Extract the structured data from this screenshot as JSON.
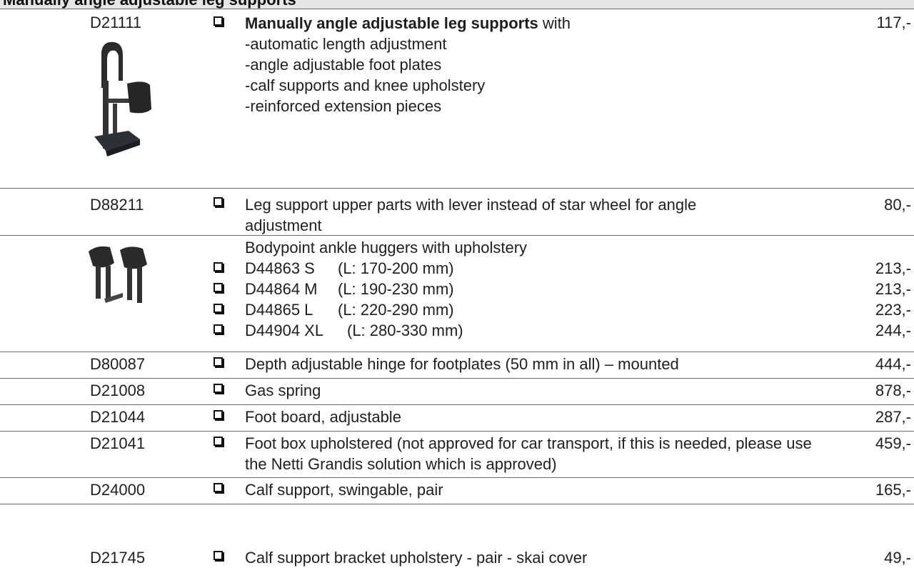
{
  "header": {
    "title": "Manually angle adjustable leg supports"
  },
  "item1": {
    "code": "D21111",
    "desc_bold": "Manually angle adjustable leg supports",
    "desc_rest": " with",
    "bullets": [
      "-automatic length adjustment",
      "-angle adjustable foot plates",
      "-calf supports and knee upholstery",
      "-reinforced extension pieces"
    ],
    "price": "117,-"
  },
  "item2": {
    "code": "D88211",
    "desc": "Leg support upper parts with lever instead of star wheel for angle adjustment",
    "price": "80,-"
  },
  "ankle": {
    "title": "Bodypoint ankle huggers with upholstery",
    "sizes": [
      {
        "code": "D44863 S",
        "range": "(L: 170-200 mm)",
        "price": "213,-"
      },
      {
        "code": "D44864 M",
        "range": "(L: 190-230 mm)",
        "price": "213,-"
      },
      {
        "code": "D44865 L",
        "range": "(L: 220-290 mm)",
        "price": "223,-"
      },
      {
        "code": "D44904 XL",
        "range": "(L: 280-330 mm)",
        "price": "244,-"
      }
    ]
  },
  "rows": [
    {
      "code": "D80087",
      "desc": "Depth adjustable hinge for footplates (50 mm in all) – mounted",
      "price": "444,-"
    },
    {
      "code": "D21008",
      "desc": "Gas spring",
      "price": "878,-"
    },
    {
      "code": "D21044",
      "desc": "Foot board, adjustable",
      "price": "287,-"
    },
    {
      "code": "D21041",
      "desc": "Foot box upholstered (not approved for car transport, if this is needed, please use the Netti Grandis solution which is approved)",
      "price": "459,-"
    },
    {
      "code": "D24000",
      "desc": "Calf support, swingable, pair",
      "price": "165,-"
    },
    {
      "code": "D21745",
      "desc": "Calf support bracket upholstery - pair - skai cover",
      "price": "49,-"
    }
  ]
}
